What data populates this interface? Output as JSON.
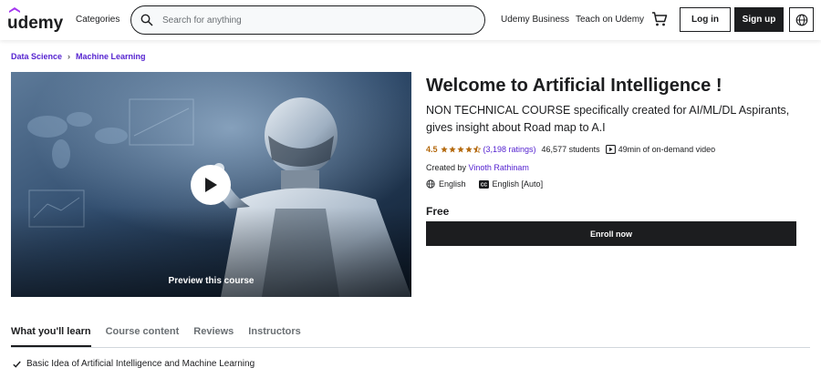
{
  "header": {
    "logo_text": "udemy",
    "categories_label": "Categories",
    "search_placeholder": "Search for anything",
    "udemy_business_label": "Udemy Business",
    "teach_label": "Teach on Udemy",
    "login_label": "Log in",
    "signup_label": "Sign up",
    "icons": {
      "search": "search-icon",
      "cart": "cart-icon",
      "language": "globe-icon"
    }
  },
  "breadcrumb": [
    "Data Science",
    "Machine Learning"
  ],
  "preview": {
    "label": "Preview this course",
    "icon": "play-icon"
  },
  "course": {
    "title": "Welcome to Artificial Intelligence !",
    "subtitle": "NON TECHNICAL COURSE specifically created for AI/ML/DL Aspirants, gives insight about Road map to A.I",
    "rating": "4.5",
    "rating_stars": 4.5,
    "ratings_count": "(3,198 ratings)",
    "students": "46,577 students",
    "video": "49min of on-demand video",
    "created_by_label": "Created by",
    "instructor": "Vinoth Rathinam",
    "language": "English",
    "captions": "English [Auto]",
    "price": "Free",
    "enroll_label": "Enroll now"
  },
  "tabs": [
    {
      "label": "What you'll learn",
      "active": true
    },
    {
      "label": "Course content",
      "active": false
    },
    {
      "label": "Reviews",
      "active": false
    },
    {
      "label": "Instructors",
      "active": false
    }
  ],
  "learn_items": [
    "Basic Idea of Artificial Intelligence and Machine Learning"
  ],
  "colors": {
    "accent": "#5624d0",
    "rating": "#b4690e",
    "dark": "#1c1d1f",
    "logo_red": "#a435f0"
  }
}
